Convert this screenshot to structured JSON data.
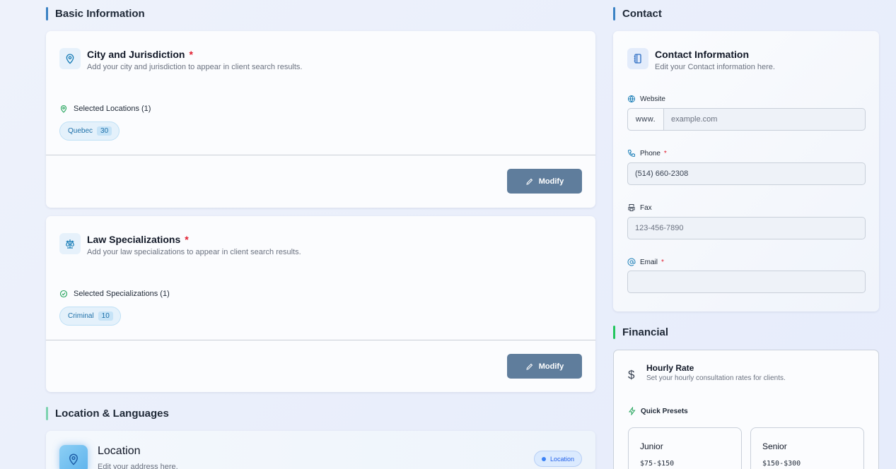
{
  "sections": {
    "basic_info": "Basic Information",
    "contact": "Contact",
    "financial": "Financial",
    "location_languages": "Location & Languages"
  },
  "city_card": {
    "title": "City and Jurisdiction",
    "required_mark": "*",
    "subtitle": "Add your city and jurisdiction to appear in client search results.",
    "selected_label": "Selected Locations (1)",
    "chips": [
      {
        "label": "Quebec",
        "count": "30"
      }
    ],
    "modify_label": "Modify",
    "icon": "map-pin-icon"
  },
  "law_card": {
    "title": "Law Specializations",
    "required_mark": "*",
    "subtitle": "Add your law specializations to appear in client search results.",
    "selected_label": "Selected Specializations (1)",
    "chips": [
      {
        "label": "Criminal",
        "count": "10"
      }
    ],
    "modify_label": "Modify",
    "icon": "scales-icon"
  },
  "location_card": {
    "title": "Location",
    "subtitle": "Edit your address here.",
    "badge": "Location"
  },
  "contact_card": {
    "title": "Contact Information",
    "subtitle": "Edit your Contact information here.",
    "website": {
      "label": "Website",
      "prefix": "www.",
      "placeholder": "example.com"
    },
    "phone": {
      "label": "Phone",
      "required_mark": "*",
      "value": "(514) 660-2308"
    },
    "fax": {
      "label": "Fax",
      "placeholder": "123-456-7890"
    },
    "email": {
      "label": "Email",
      "required_mark": "*",
      "value": ""
    }
  },
  "financial_card": {
    "title": "Hourly Rate",
    "subtitle": "Set your hourly consultation rates for clients.",
    "presets_label": "Quick Presets",
    "presets": [
      {
        "name": "Junior",
        "range": "$75-$150"
      },
      {
        "name": "Senior",
        "range": "$150-$300"
      }
    ]
  },
  "colors": {
    "accent_blue": "#3b82c4",
    "accent_green": "#22c55e",
    "button": "#5f7d9c",
    "required": "#e11d2e"
  }
}
